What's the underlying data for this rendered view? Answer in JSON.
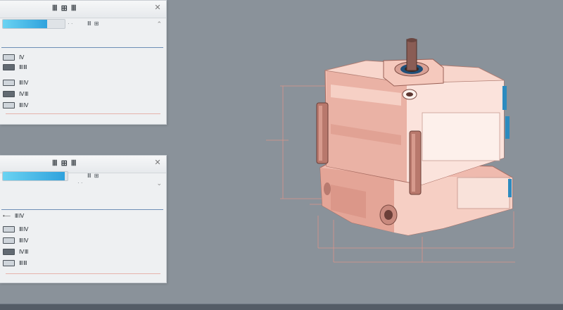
{
  "panel_top": {
    "title": "Ⅲ ⊞ Ⅲ",
    "progress_value": 0.72,
    "progress_label": "Ⅲ ⊞",
    "toolbar_mini": "· ·",
    "rows": [
      {
        "label": "Ⅳ",
        "icon": "layer-icon"
      },
      {
        "label": "ⅢⅢ",
        "icon": "layer-icon"
      },
      {
        "label": "ⅢⅣ",
        "icon": "layer-icon"
      },
      {
        "label": "ⅣⅢ",
        "icon": "layer-icon"
      },
      {
        "label": "ⅢⅣ",
        "icon": "layer-icon"
      }
    ]
  },
  "panel_bottom": {
    "title": "Ⅲ ⊞ Ⅲ",
    "progress_value": 0.96,
    "progress_label": "Ⅲ ⊞",
    "toolbar_mini": "· ·",
    "rows": [
      {
        "label": "ⅢⅣ",
        "icon": "layer-icon"
      },
      {
        "label": "ⅢⅣ",
        "icon": "layer-icon"
      },
      {
        "label": "ⅢⅣ",
        "icon": "layer-icon"
      },
      {
        "label": "ⅣⅢ",
        "icon": "layer-icon"
      },
      {
        "label": "ⅢⅢ",
        "icon": "layer-icon"
      }
    ]
  },
  "colors": {
    "background": "#8a929a",
    "panel": "#eef0f2",
    "accent_blue": "#2fa2dd",
    "part_pink": "#f4c7bb",
    "part_dark": "#b27f74",
    "dimension_red": "#d9948a"
  }
}
